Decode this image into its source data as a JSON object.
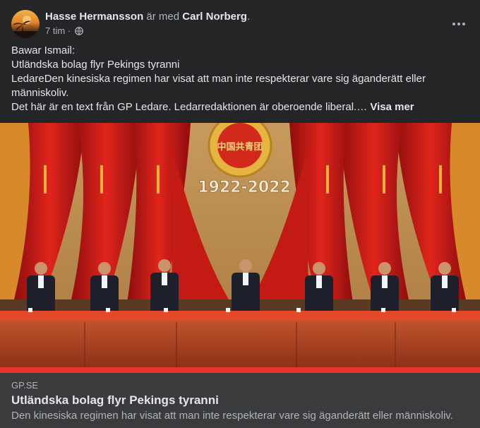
{
  "post": {
    "author": "Hasse Hermansson",
    "with_text": "är med",
    "tagged": "Carl Norberg",
    "period": ".",
    "time": "7 tim",
    "separator": "·",
    "lines": [
      "Bawar Ismail:",
      "Utländska bolag flyr Pekings tyranni",
      "LedareDen kinesiska regimen har visat att man inte respekterar vare sig äganderätt eller",
      "människoliv.",
      "Det här är en text från GP Ledare. Ledarredaktionen är oberoende liberal.…"
    ],
    "see_more": "Visa mer",
    "menu_icon": "more-horizontal-icon",
    "privacy_icon": "globe-icon"
  },
  "image": {
    "banner_text": "1922-2022",
    "emblem_text": "中国共青团"
  },
  "link": {
    "domain": "GP.SE",
    "title": "Utländska bolag flyr Pekings tyranni",
    "description": "Den kinesiska regimen har visat att man inte respekterar vare sig äganderätt eller människoliv."
  },
  "colors": {
    "background": "#242526",
    "link_box": "#3a3b3c",
    "text_primary": "#e4e6eb",
    "text_secondary": "#b0b3b8"
  }
}
